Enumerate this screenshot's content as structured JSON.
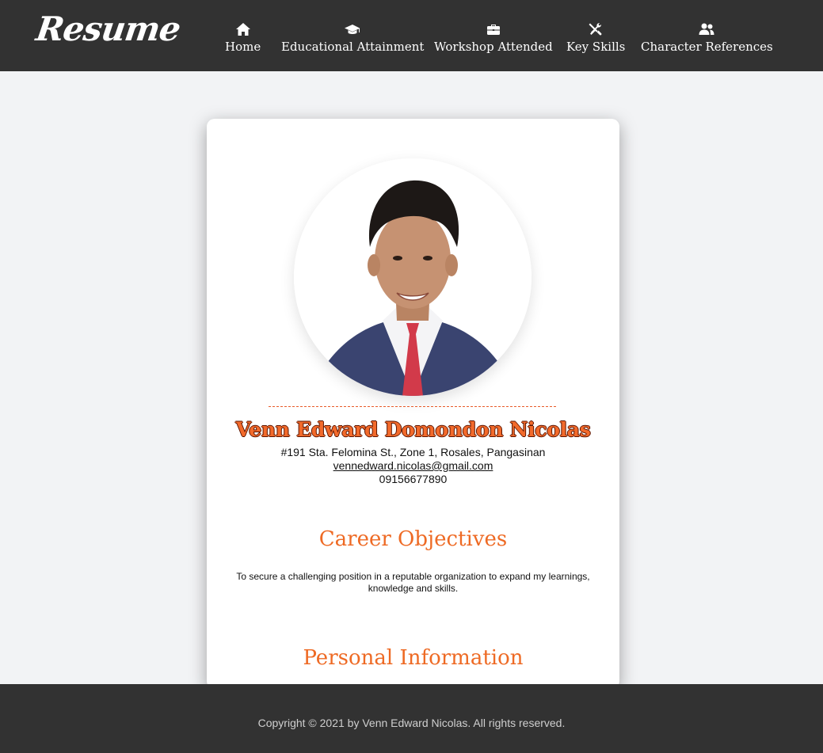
{
  "header": {
    "logo": "Resume",
    "nav": [
      {
        "label": "Home",
        "icon": "home-icon"
      },
      {
        "label": "Educational Attainment",
        "icon": "graduation-cap-icon"
      },
      {
        "label": "Workshop Attended",
        "icon": "briefcase-icon"
      },
      {
        "label": "Key Skills",
        "icon": "tools-icon"
      },
      {
        "label": "Character References",
        "icon": "users-icon"
      }
    ]
  },
  "profile": {
    "name": "Venn Edward Domondon Nicolas",
    "address": "#191 Sta. Felomina St., Zone 1, Rosales, Pangasinan",
    "email": "vennedward.nicolas@gmail.com",
    "phone": "09156677890"
  },
  "sections": {
    "career_title": "Career Objectives",
    "career_text": "To secure a challenging position in a reputable organization to expand my learnings, knowledge and skills.",
    "personal_title": "Personal Information"
  },
  "footer": {
    "copyright": "Copyright © 2021 by Venn Edward Nicolas. All rights reserved."
  },
  "colors": {
    "nav_background": "#323232",
    "accent": "#ee6a24",
    "page_background": "#f2f3f5"
  }
}
